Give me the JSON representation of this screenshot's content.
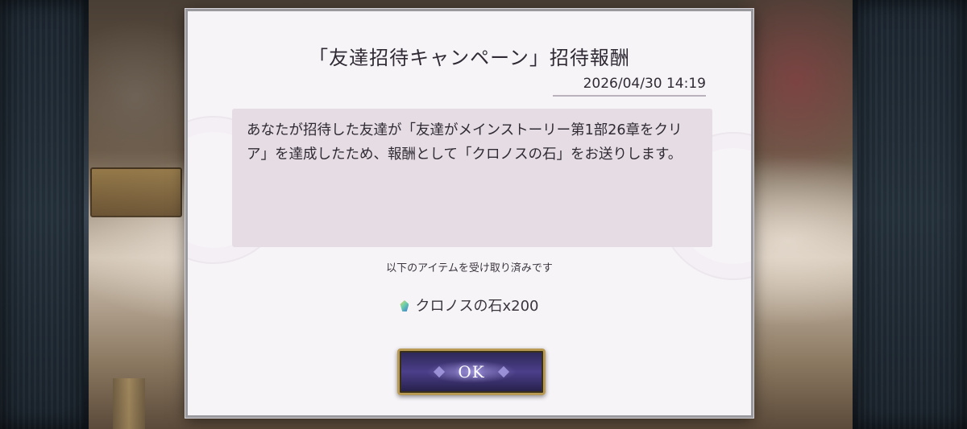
{
  "dialog": {
    "title": "「友達招待キャンペーン」招待報酬",
    "timestamp": "2026/04/30 14:19",
    "message_line1": "あなたが招待した友達が「友達がメインストーリー第1部26章をクリ",
    "message_line2": "ア」を達成したため、報酬として「クロノスの石」をお送りします。",
    "received_label": "以下のアイテムを受け取り済みです",
    "reward": {
      "icon": "chronos-stone-icon",
      "text": "クロノスの石x200"
    },
    "ok_button_label": "OK"
  },
  "colors": {
    "dialog_background": "#f7f4f8",
    "message_background": "#e5dce4",
    "button_background": "#4b3f8a",
    "button_border": "#b99a55"
  }
}
